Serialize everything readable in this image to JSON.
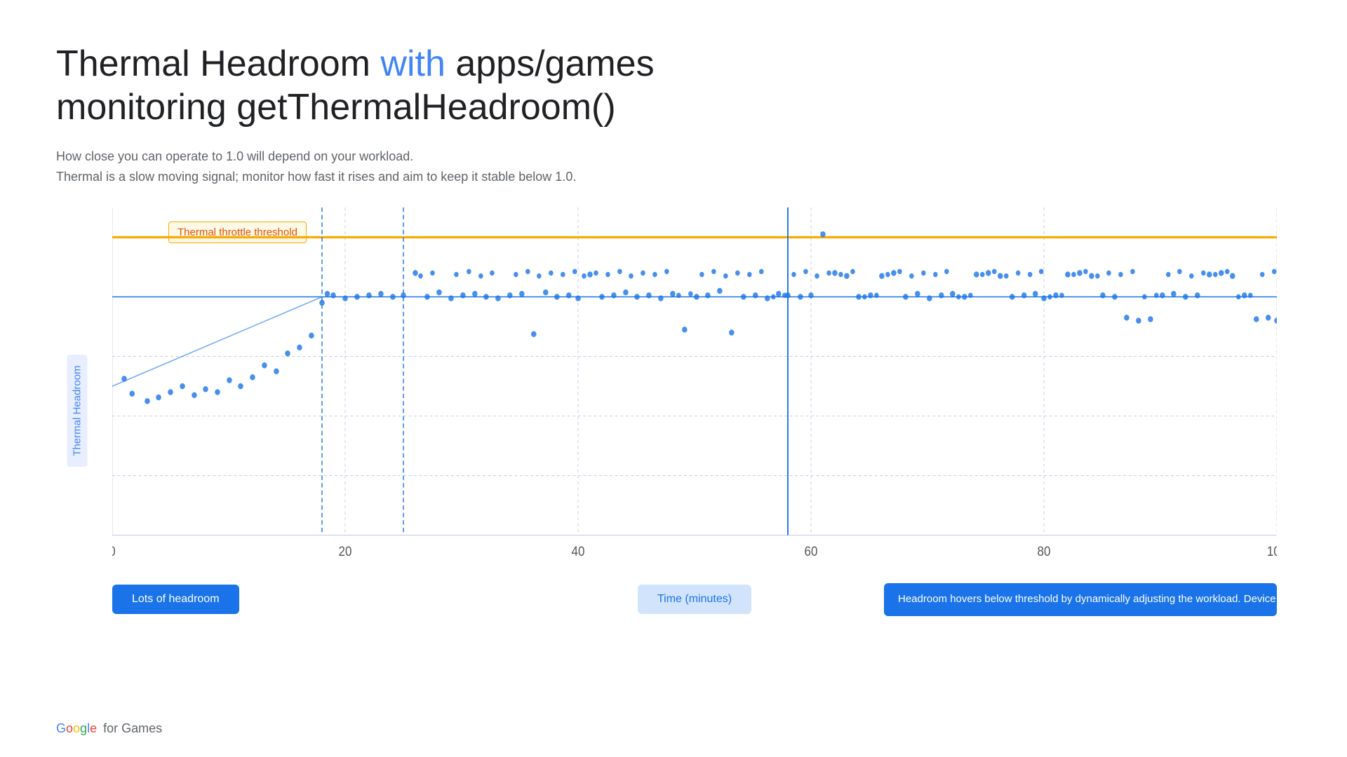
{
  "page": {
    "title_part1": "Thermal Headroom ",
    "title_with": "with",
    "title_part2": " apps/games",
    "title_line2": "monitoring getThermalHeadroom()",
    "subtitle_line1": "How close you can operate to 1.0 will depend on your workload.",
    "subtitle_line2": "Thermal is a slow moving signal; monitor how fast it rises and aim to keep it stable below 1.0.",
    "annotation_label": "Thermal throttle threshold",
    "y_axis_label": "Thermal Headroom",
    "x_axis_label": "Time (minutes)",
    "label_lots": "Lots of headroom",
    "label_headroom": "Headroom hovers below threshold by dynamically adjusting the workload. Device doesn't go into throttling with ADPF",
    "google_text": "Google for Games",
    "colors": {
      "blue": "#1a73e8",
      "yellow": "#f9ab00",
      "dot": "#1a73e8",
      "line": "#1a73e8",
      "threshold": "#f9ab00",
      "grid": "#c5cae9",
      "dashed_vert": "#1a73e8"
    }
  }
}
